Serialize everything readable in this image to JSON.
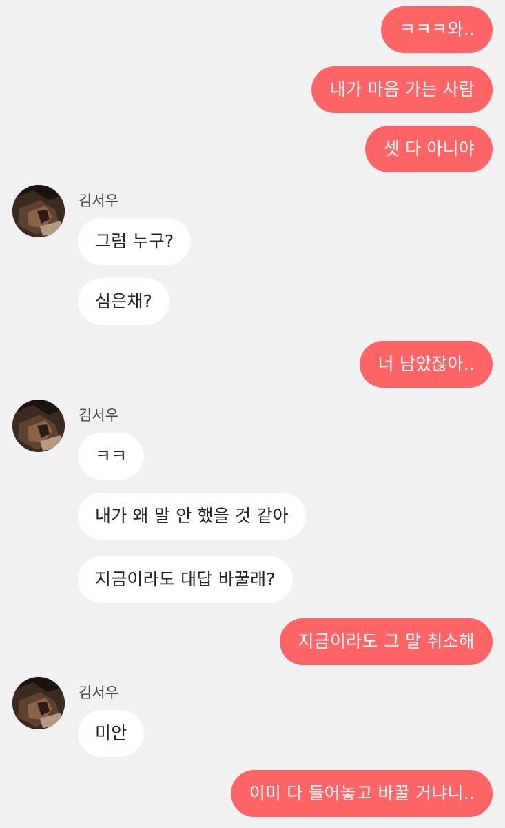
{
  "contact": {
    "name": "김서우",
    "avatar_icon": "profile-photo-icon"
  },
  "colors": {
    "background": "#f1f1f1",
    "outgoing_bubble": "#ff6466",
    "outgoing_text": "#ffffff",
    "incoming_bubble": "#ffffff",
    "incoming_text": "#222222"
  },
  "messages": [
    {
      "sender": "me",
      "text": "ㅋㅋㅋ와.."
    },
    {
      "sender": "me",
      "text": "내가 마음 가는 사람"
    },
    {
      "sender": "me",
      "text": "셋 다 아니야"
    },
    {
      "sender": "김서우",
      "text": "그럼 누구?"
    },
    {
      "sender": "김서우",
      "text": "심은채?"
    },
    {
      "sender": "me",
      "text": "너 남았잖아.."
    },
    {
      "sender": "김서우",
      "text": "ㅋㅋ"
    },
    {
      "sender": "김서우",
      "text": "내가 왜 말 안 했을 것 같아"
    },
    {
      "sender": "김서우",
      "text": "지금이라도 대답 바꿀래?"
    },
    {
      "sender": "me",
      "text": "지금이라도 그 말 취소해"
    },
    {
      "sender": "김서우",
      "text": "미안"
    },
    {
      "sender": "me",
      "text": "이미 다 들어놓고 바꿀 거냐니.."
    }
  ]
}
